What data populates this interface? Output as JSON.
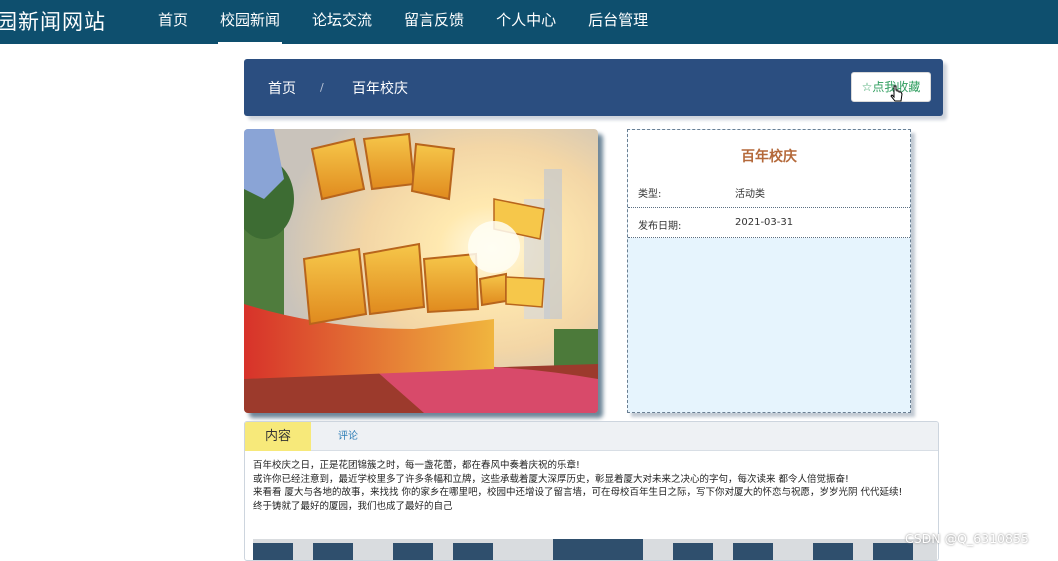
{
  "header": {
    "site_title": "园新闻网站",
    "nav": [
      {
        "label": "首页"
      },
      {
        "label": "校园新闻"
      },
      {
        "label": "论坛交流"
      },
      {
        "label": "留言反馈"
      },
      {
        "label": "个人中心"
      },
      {
        "label": "后台管理"
      }
    ],
    "active_index": 1
  },
  "breadcrumb": {
    "home": "首页",
    "separator": "/",
    "current": "百年校庆"
  },
  "favorite_button": {
    "icon": "star-outline-icon",
    "label": "☆点我收藏"
  },
  "photo": {
    "description_icon": "campus-celebration-photo",
    "alt": ""
  },
  "info": {
    "title": "百年校庆",
    "type_label": "类型:",
    "type_value": "活动类",
    "date_label": "发布日期:",
    "date_value": "2021-03-31"
  },
  "tabs": {
    "content": "内容",
    "comments": "评论"
  },
  "article": {
    "paragraphs": [
      "百年校庆之日，正是花团锦簇之时，每一盏花蕾，都在春风中奏着庆祝的乐章!",
      "或许你已经注意到，最近学校里多了许多条幅和立牌，这些承载着厦大深厚历史，彰显着厦大对未来之决心的字句，每次读来 都令人倍觉振奋!",
      "来看看 厦大与各地的故事，来找找 你的家乡在哪里吧，校园中还增设了留言墙，可在母校百年生日之际，写下你对厦大的怀恋与祝愿，岁岁光阴 代代延续!",
      "终于铸就了最好的厦园，我们也成了最好的自己"
    ]
  },
  "watermark": "CSDN @Q_6310855",
  "colors": {
    "topbar": "#0e4f6e",
    "crumbbar": "#2b4e80",
    "info_bg": "#e6f4fd",
    "title_accent": "#b4693a",
    "tab_active": "#f7e97a",
    "favorite_text": "#2e9d5e"
  }
}
